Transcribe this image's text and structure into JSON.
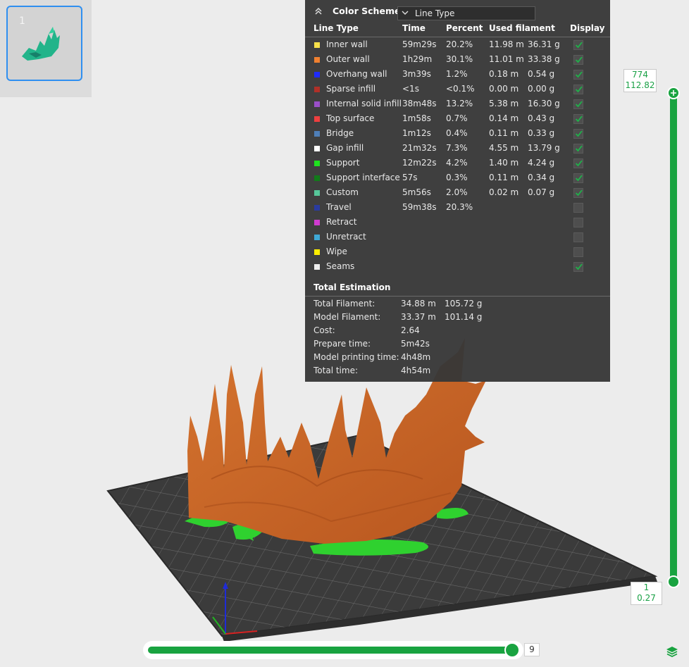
{
  "plate": {
    "number": "1"
  },
  "color_scheme": {
    "title": "Color Scheme",
    "selected": "Line Type",
    "headers": {
      "line_type": "Line Type",
      "time": "Time",
      "percent": "Percent",
      "used_filament": "Used filament",
      "display": "Display"
    },
    "rows": [
      {
        "name": "Inner wall",
        "color": "#f7e04a",
        "time": "59m29s",
        "percent": "20.2%",
        "length": "11.98 m",
        "weight": "36.31 g",
        "display": true
      },
      {
        "name": "Outer wall",
        "color": "#f08030",
        "time": "1h29m",
        "percent": "30.1%",
        "length": "11.01 m",
        "weight": "33.38 g",
        "display": true
      },
      {
        "name": "Overhang wall",
        "color": "#1f2bff",
        "time": "3m39s",
        "percent": "1.2%",
        "length": "0.18 m",
        "weight": "0.54 g",
        "display": true
      },
      {
        "name": "Sparse infill",
        "color": "#b03028",
        "time": "<1s",
        "percent": "<0.1%",
        "length": "0.00 m",
        "weight": "0.00 g",
        "display": true
      },
      {
        "name": "Internal solid infill",
        "color": "#9a4fc8",
        "time": "38m48s",
        "percent": "13.2%",
        "length": "5.38 m",
        "weight": "16.30 g",
        "display": true
      },
      {
        "name": "Top surface",
        "color": "#ee3f3f",
        "time": "1m58s",
        "percent": "0.7%",
        "length": "0.14 m",
        "weight": "0.43 g",
        "display": true
      },
      {
        "name": "Bridge",
        "color": "#4f7fb8",
        "time": "1m12s",
        "percent": "0.4%",
        "length": "0.11 m",
        "weight": "0.33 g",
        "display": true
      },
      {
        "name": "Gap infill",
        "color": "#ffffff",
        "time": "21m32s",
        "percent": "7.3%",
        "length": "4.55 m",
        "weight": "13.79 g",
        "display": true
      },
      {
        "name": "Support",
        "color": "#1fe21f",
        "time": "12m22s",
        "percent": "4.2%",
        "length": "1.40 m",
        "weight": "4.24 g",
        "display": true
      },
      {
        "name": "Support interface",
        "color": "#117a1a",
        "time": "57s",
        "percent": "0.3%",
        "length": "0.11 m",
        "weight": "0.34 g",
        "display": true
      },
      {
        "name": "Custom",
        "color": "#56c79a",
        "time": "5m56s",
        "percent": "2.0%",
        "length": "0.02 m",
        "weight": "0.07 g",
        "display": true
      },
      {
        "name": "Travel",
        "color": "#2a3ba0",
        "time": "59m38s",
        "percent": "20.3%",
        "length": "",
        "weight": "",
        "display": false
      },
      {
        "name": "Retract",
        "color": "#d13bd1",
        "time": "",
        "percent": "",
        "length": "",
        "weight": "",
        "display": false
      },
      {
        "name": "Unretract",
        "color": "#3fa9d6",
        "time": "",
        "percent": "",
        "length": "",
        "weight": "",
        "display": false
      },
      {
        "name": "Wipe",
        "color": "#ffee00",
        "time": "",
        "percent": "",
        "length": "",
        "weight": "",
        "display": false
      },
      {
        "name": "Seams",
        "color": "#eeeeee",
        "time": "",
        "percent": "",
        "length": "",
        "weight": "",
        "display": true
      }
    ]
  },
  "total_estimation": {
    "title": "Total Estimation",
    "rows": [
      {
        "label": "Total Filament:",
        "value1": "34.88 m",
        "value2": "105.72 g"
      },
      {
        "label": "Model Filament:",
        "value1": "33.37 m",
        "value2": "101.14 g"
      },
      {
        "label": "Cost:",
        "value1": "2.64",
        "value2": ""
      },
      {
        "label": "Prepare time:",
        "value1": "5m42s",
        "value2": ""
      },
      {
        "label": "Model printing time:",
        "value1": "4h48m",
        "value2": ""
      },
      {
        "label": "Total time:",
        "value1": "4h54m",
        "value2": ""
      }
    ]
  },
  "layer_slider": {
    "top_layer": "774",
    "top_height": "112.82",
    "bottom_layer": "1",
    "bottom_height": "0.27"
  },
  "move_slider": {
    "value": "9"
  },
  "colors": {
    "accent": "#19a340",
    "model": "#c9662a",
    "support": "#1fd21f",
    "bed": "#3a3a3a"
  }
}
